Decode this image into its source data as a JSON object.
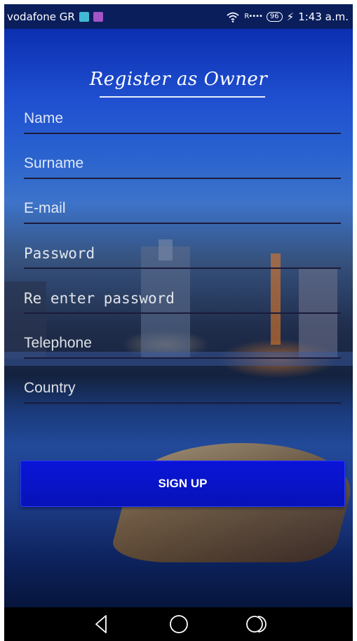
{
  "status_bar": {
    "carrier": "vodafone GR",
    "signal": "R••••",
    "battery": "96",
    "time": "1:43 a.m."
  },
  "form": {
    "title": "Register as  Owner",
    "fields": [
      {
        "placeholder": "Name",
        "value": ""
      },
      {
        "placeholder": "Surname",
        "value": ""
      },
      {
        "placeholder": "E-mail",
        "value": ""
      },
      {
        "placeholder": "Password",
        "value": ""
      },
      {
        "placeholder": "Re enter password",
        "value": ""
      },
      {
        "placeholder": "Telephone",
        "value": ""
      },
      {
        "placeholder": "Country",
        "value": ""
      }
    ],
    "submit_label": "SIGN UP"
  },
  "nav_bar": {
    "back_icon": "back-triangle-icon",
    "home_icon": "home-circle-icon",
    "recents_icon": "recents-icon"
  },
  "colors": {
    "button": "#0a14d8",
    "status_bar": "#0a1e5c"
  }
}
